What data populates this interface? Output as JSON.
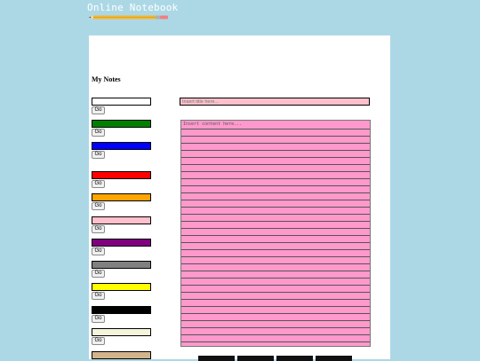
{
  "app": {
    "title": "Online Notebook"
  },
  "notes": {
    "heading": "My Notes",
    "go_label": "Go",
    "swatches": [
      {
        "color": "#ffffff"
      },
      {
        "color": "#008000"
      },
      {
        "color": "#0000ff"
      },
      {
        "color": "#ff0000"
      },
      {
        "color": "#ffa500"
      },
      {
        "color": "#ffc0cb"
      },
      {
        "color": "#800080"
      },
      {
        "color": "#808080"
      },
      {
        "color": "#ffff00"
      },
      {
        "color": "#000000"
      },
      {
        "color": "#f5f5dc"
      },
      {
        "color": "#d2b48c"
      }
    ]
  },
  "editor": {
    "title_placeholder": "Insert title here...",
    "content_placeholder": "Insert content here...",
    "paper_color": "#ff99cc",
    "title_color": "#ffc0cb"
  },
  "icons": {
    "logo": "pencil-icon"
  }
}
